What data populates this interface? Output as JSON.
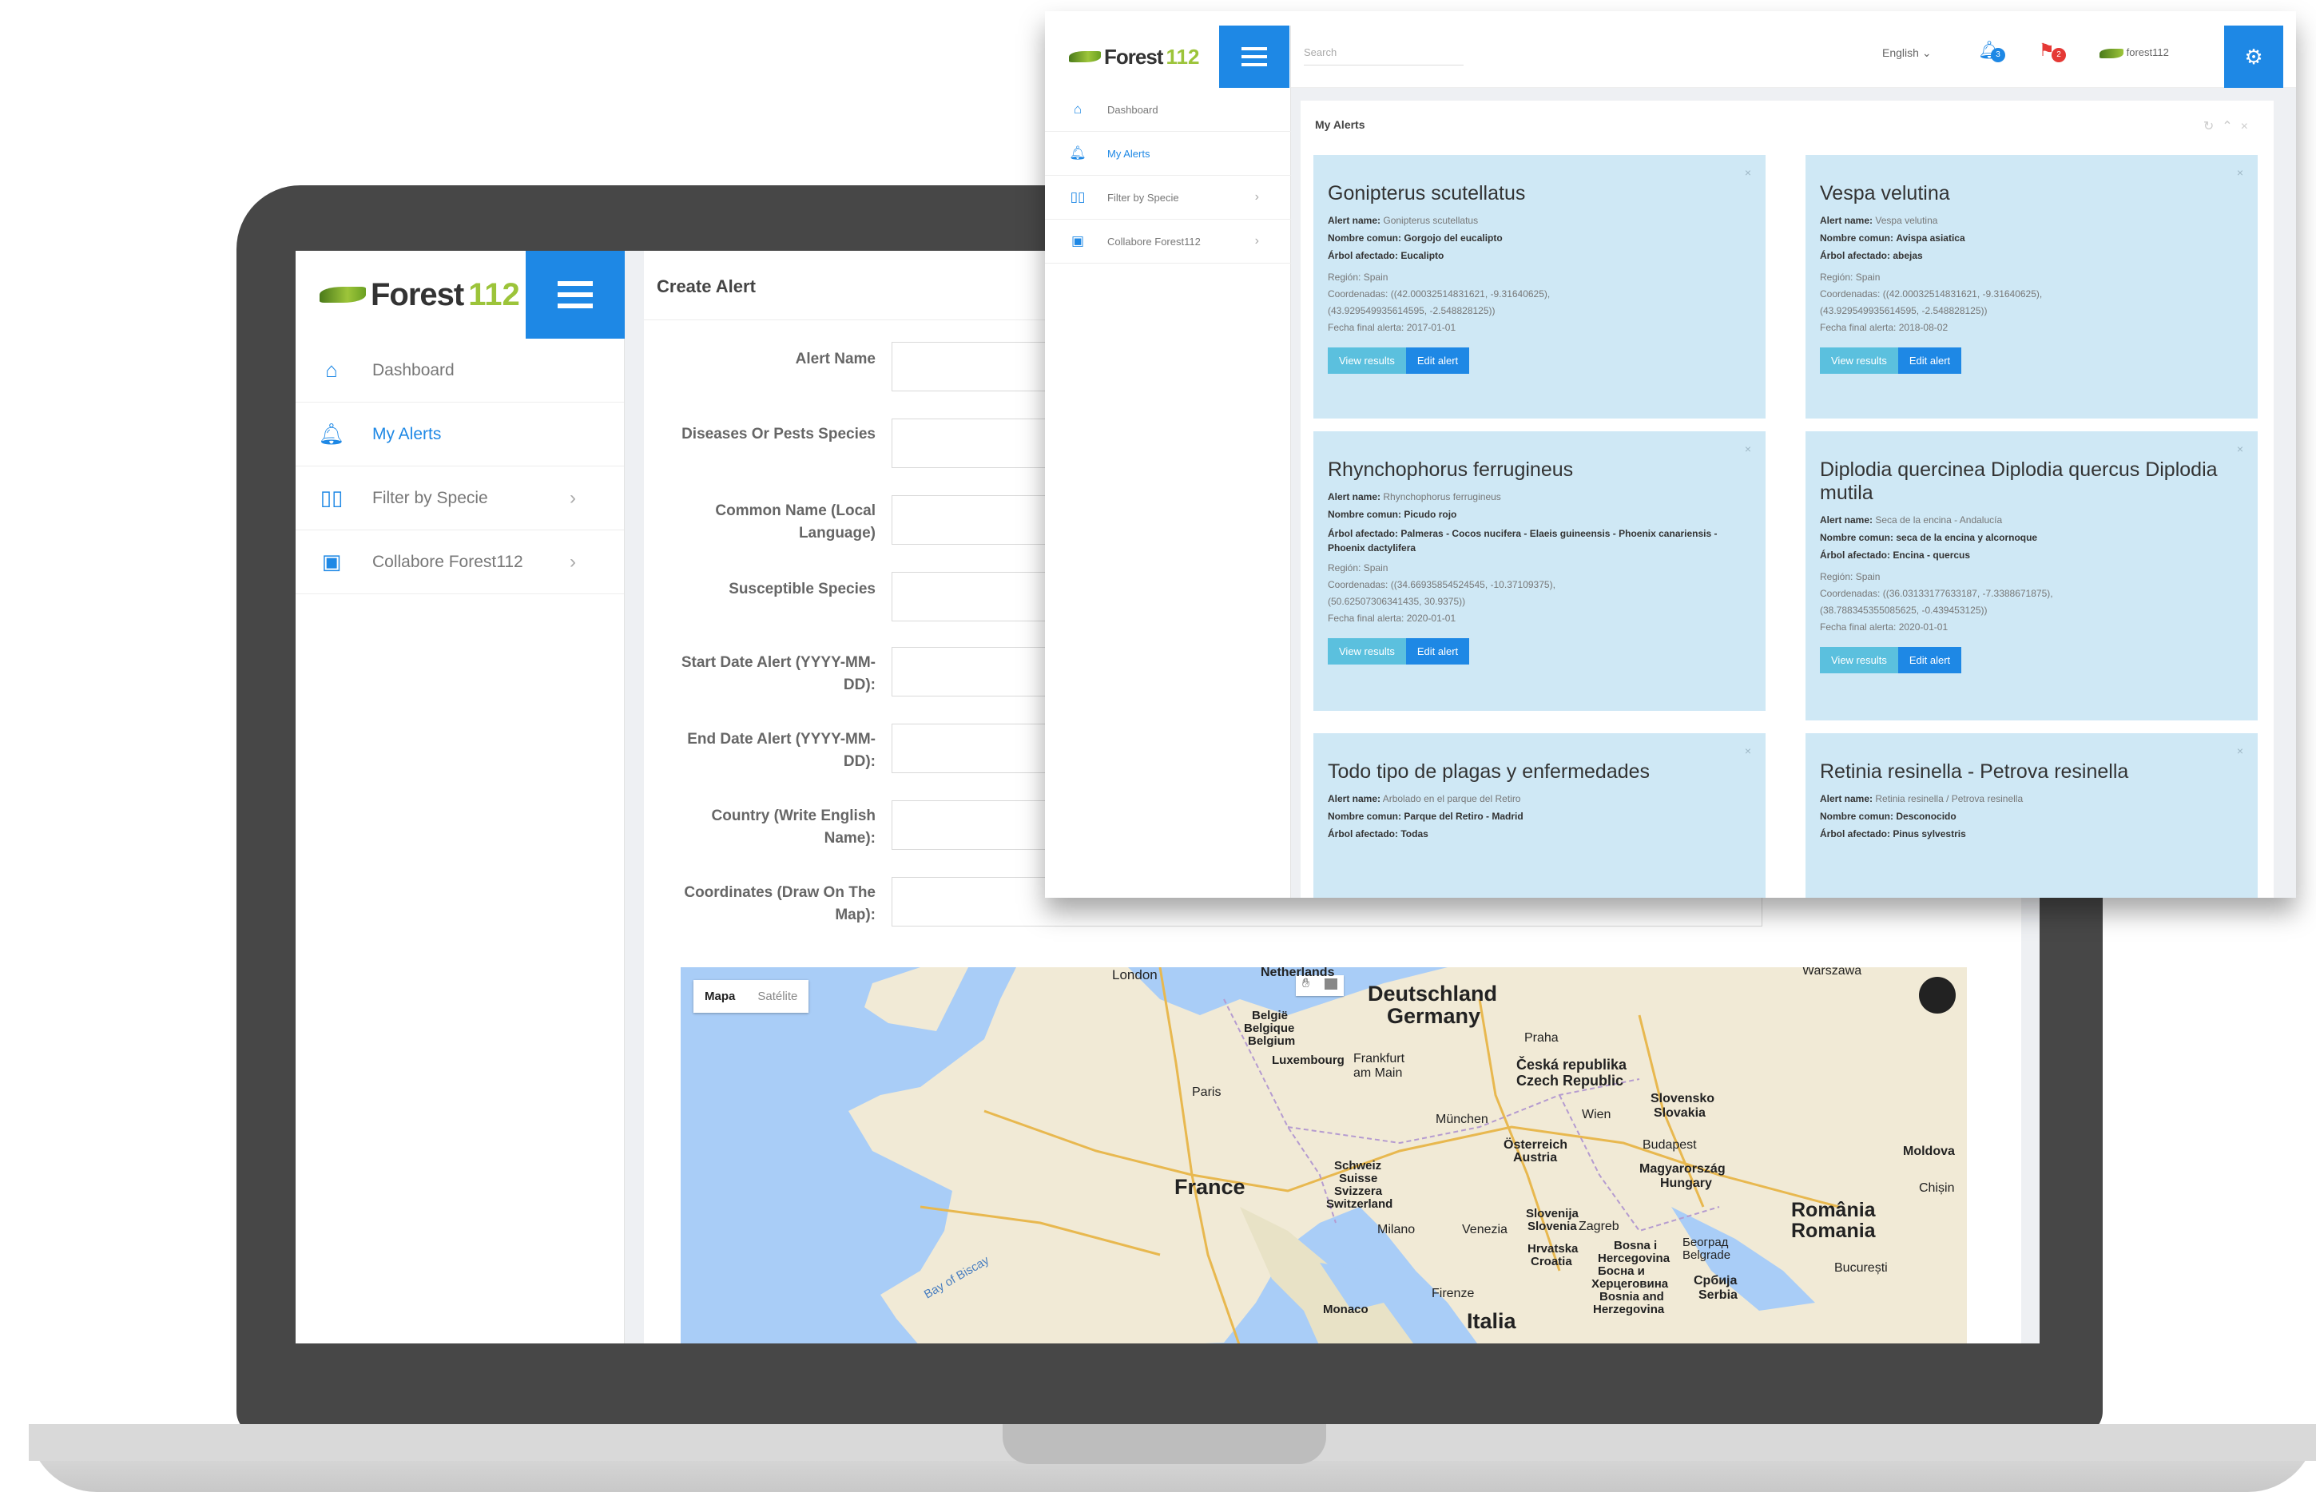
{
  "laptop": {
    "brand": {
      "name": "Forest",
      "num": "112"
    },
    "sidebar": {
      "items": [
        {
          "label": "Dashboard",
          "icon": "home-icon"
        },
        {
          "label": "My Alerts",
          "icon": "bell-icon"
        },
        {
          "label": "Filter by Specie",
          "icon": "book-icon"
        },
        {
          "label": "Collabore Forest112",
          "icon": "image-icon"
        }
      ]
    },
    "page_title": "Create Alert",
    "form": [
      {
        "label": "Alert Name"
      },
      {
        "label": "Diseases Or Pests Species"
      },
      {
        "label": "Common Name (Local Language)"
      },
      {
        "label": "Susceptible Species"
      },
      {
        "label": "Start Date Alert (YYYY-MM-DD):"
      },
      {
        "label": "End Date Alert (YYYY-MM-DD):"
      },
      {
        "label": "Country (Write English Name):"
      },
      {
        "label": "Coordinates (Draw On The Map):"
      }
    ],
    "map": {
      "type_buttons": [
        "Mapa",
        "Satélite"
      ],
      "labels": {
        "london": "London",
        "netherlands": "Netherlands",
        "deutschland": "Deutschland",
        "germany": "Germany",
        "belgie": "België",
        "belgique": "Belgique",
        "belgium": "Belgium",
        "luxembourg": "Luxembourg",
        "frankfurt": "Frankfurt",
        "am_main": "am Main",
        "praha": "Praha",
        "ceska": "Česká republika",
        "czech": "Czech Republic",
        "paris": "Paris",
        "munchen": "München",
        "wien": "Wien",
        "slovensko": "Slovensko",
        "slovakia": "Slovakia",
        "budapest": "Budapest",
        "osterreich": "Österreich",
        "austria": "Austria",
        "schweiz": "Schweiz",
        "suisse": "Suisse",
        "svizzera": "Svizzera",
        "switzerland": "Switzerland",
        "france": "France",
        "magyar": "Magyarország",
        "hungary": "Hungary",
        "moldova": "Moldova",
        "chisinau": "Chișin",
        "milano": "Milano",
        "venezia": "Venezia",
        "slovenija": "Slovenija",
        "slovenia": "Slovenia",
        "zagreb": "Zagreb",
        "hrvatska": "Hrvatska",
        "croatia": "Croatia",
        "bosna": "Bosna i",
        "hercegovina": "Hercegovina",
        "beograd": "Београд",
        "belgrade": "Belgrade",
        "romania1": "România",
        "romania2": "Romania",
        "bucuresti": "București",
        "bay_biscay": "Bay of Biscay",
        "monaco": "Monaco",
        "firenze": "Firenze",
        "italia": "Italia",
        "srbija": "Србија",
        "serbia": "Serbia",
        "bosna_cyr": "Босна и",
        "herceg_cyr": "Херцеговина",
        "bosnia": "Bosnia and",
        "herzegovina": "Herzegovina",
        "warszawa": "Warszawa"
      }
    }
  },
  "window": {
    "brand": {
      "name": "Forest",
      "num": "112"
    },
    "sidebar": {
      "items": [
        {
          "label": "Dashboard",
          "icon": "home-icon"
        },
        {
          "label": "My Alerts",
          "icon": "bell-icon"
        },
        {
          "label": "Filter by Specie",
          "icon": "book-icon"
        },
        {
          "label": "Collabore Forest112",
          "icon": "image-icon"
        }
      ]
    },
    "search_placeholder": "Search",
    "language": "English",
    "user": "forest112",
    "panel_title": "My Alerts",
    "btn_view": "View results",
    "btn_edit": "Edit alert",
    "labels": {
      "alert_name": "Alert name:",
      "common_name": "Nombre comun:",
      "tree": "Árbol afectado:",
      "region": "Región:",
      "coords": "Coordenadas:",
      "end_date": "Fecha final alerta:"
    },
    "cards": [
      {
        "title": "Gonipterus scutellatus",
        "alert_name": "Gonipterus scutellatus",
        "common_name": "Gorgojo del eucalipto",
        "tree": "Eucalipto",
        "region": "Spain",
        "coords1": "((42.00032514831621, -9.31640625),",
        "coords2": "(43.929549935614595, -2.548828125))",
        "end_date": "2017-01-01"
      },
      {
        "title": "Vespa velutina",
        "alert_name": "Vespa velutina",
        "common_name": "Avispa asiatica",
        "tree": "abejas",
        "region": "Spain",
        "coords1": "((42.00032514831621, -9.31640625),",
        "coords2": "(43.929549935614595, -2.548828125))",
        "end_date": "2018-08-02"
      },
      {
        "title": "Rhynchophorus ferrugineus",
        "alert_name": "Rhynchophorus ferrugineus",
        "common_name": "Picudo rojo",
        "tree": "Palmeras - Cocos nucifera - Elaeis guineensis - Phoenix canariensis - Phoenix dactylifera",
        "region": "Spain",
        "coords1": "((34.66935854524545, -10.37109375),",
        "coords2": "(50.62507306341435, 30.9375))",
        "end_date": "2020-01-01"
      },
      {
        "title": "Diplodia quercinea Diplodia quercus Diplodia mutila",
        "alert_name": "Seca de la encina - Andalucía",
        "common_name": "seca de la encina y alcornoque",
        "tree": "Encina - quercus",
        "region": "Spain",
        "coords1": "((36.03133177633187, -7.3388671875),",
        "coords2": "(38.788345355085625, -0.439453125))",
        "end_date": "2020-01-01"
      },
      {
        "title": "Todo tipo de plagas y enfermedades",
        "alert_name": "Arbolado en el parque del Retiro",
        "common_name": "Parque del Retiro - Madrid",
        "tree": "Todas"
      },
      {
        "title": "Retinia resinella - Petrova resinella",
        "alert_name": "Retinia resinella / Petrova resinella",
        "common_name": "Desconocido",
        "tree": "Pinus sylvestris"
      }
    ],
    "badges": {
      "a": "3",
      "b": "2"
    }
  },
  "colors": {
    "primary": "#1e88e5",
    "card_bg": "#cfe8f5",
    "view_btn": "#5bc0de",
    "brand_green": "#9cc43a",
    "laptop": "#474747"
  }
}
